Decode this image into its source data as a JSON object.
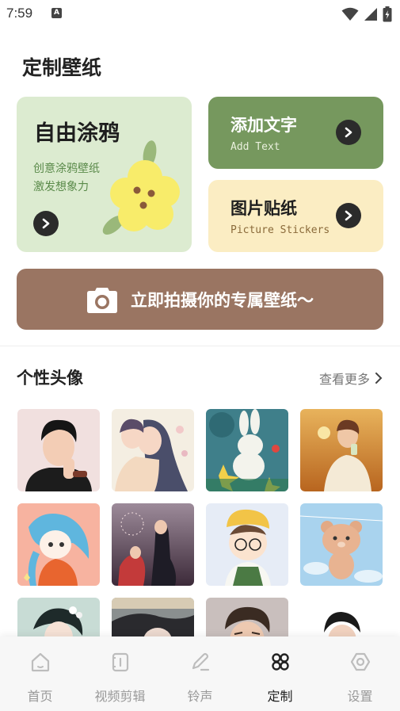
{
  "status_bar": {
    "time": "7:59",
    "notification_glyph": "A"
  },
  "page_title": "定制壁纸",
  "cards": {
    "doodle": {
      "title": "自由涂鸦",
      "desc_line1": "创意涂鸦壁纸",
      "desc_line2": "激发想象力"
    },
    "add_text": {
      "title": "添加文字",
      "subtitle": "Add Text"
    },
    "stickers": {
      "title": "图片贴纸",
      "subtitle": "Picture Stickers"
    }
  },
  "camera_button": {
    "label": "立即拍摄你的专属壁纸～",
    "icon": "camera-icon"
  },
  "avatars_section": {
    "title": "个性头像",
    "more_label": "查看更多"
  },
  "avatars": [
    {
      "name": "avatar-boy-black-shirt",
      "bg": "#f1e0df"
    },
    {
      "name": "avatar-couple-anime",
      "bg": "#f4eee2"
    },
    {
      "name": "avatar-bunny-stars",
      "bg": "#3f7f8a"
    },
    {
      "name": "avatar-boy-sunset",
      "bg": "#d79a4f"
    },
    {
      "name": "avatar-blue-hair-girl",
      "bg": "#f7b3a0"
    },
    {
      "name": "avatar-couple-fireworks",
      "bg": "#6e4960"
    },
    {
      "name": "avatar-cartoon-boy-glasses",
      "bg": "#e6ecf6"
    },
    {
      "name": "avatar-bear-sky",
      "bg": "#a9d3ee"
    },
    {
      "name": "avatar-girl-flower",
      "bg": "#c8dcd5"
    },
    {
      "name": "avatar-girl-dark-hair",
      "bg": "#8a8f8f"
    },
    {
      "name": "avatar-man-portrait",
      "bg": "#c9bfbd"
    },
    {
      "name": "avatar-boy-white",
      "bg": "#ffffff"
    }
  ],
  "bottom_nav": {
    "items": [
      {
        "label": "首页",
        "icon": "home-icon"
      },
      {
        "label": "视频剪辑",
        "icon": "video-edit-icon"
      },
      {
        "label": "铃声",
        "icon": "ringtone-icon"
      },
      {
        "label": "定制",
        "icon": "customize-icon",
        "active": true
      },
      {
        "label": "设置",
        "icon": "settings-icon"
      }
    ]
  },
  "colors": {
    "doodle_card": "#dcebd0",
    "text_card": "#76985e",
    "sticker_card": "#fbedc3",
    "camera_button": "#9a7562"
  }
}
